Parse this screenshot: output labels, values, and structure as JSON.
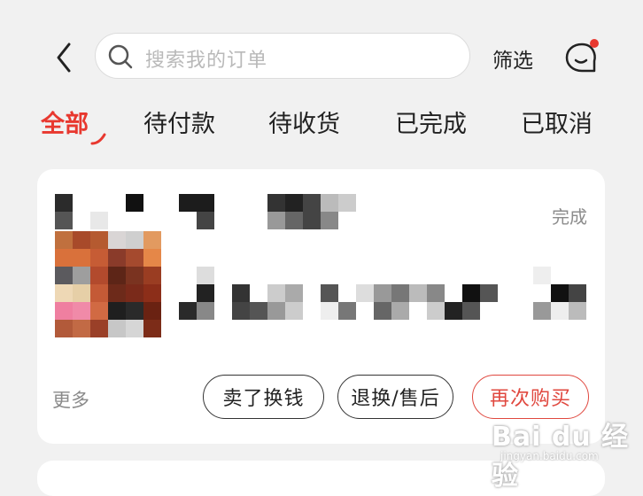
{
  "header": {
    "search_placeholder": "搜索我的订单",
    "filter_label": "筛选",
    "message_icon": "chat-bubble-icon",
    "notification_dot_color": "#e8382f"
  },
  "tabs": [
    {
      "label": "全部",
      "active": true
    },
    {
      "label": "待付款",
      "active": false
    },
    {
      "label": "待收货",
      "active": false
    },
    {
      "label": "已完成",
      "active": false
    },
    {
      "label": "已取消",
      "active": false
    }
  ],
  "order": {
    "status": "完成",
    "more_label": "更多",
    "buttons": {
      "sell": "卖了换钱",
      "return": "退换/售后",
      "rebuy": "再次购买"
    }
  },
  "colors": {
    "accent": "#e8382f",
    "background": "#f1f1f1",
    "card": "#ffffff"
  },
  "watermark": {
    "text": "Bai du 经验",
    "url": "jingyan.baidu.com"
  }
}
